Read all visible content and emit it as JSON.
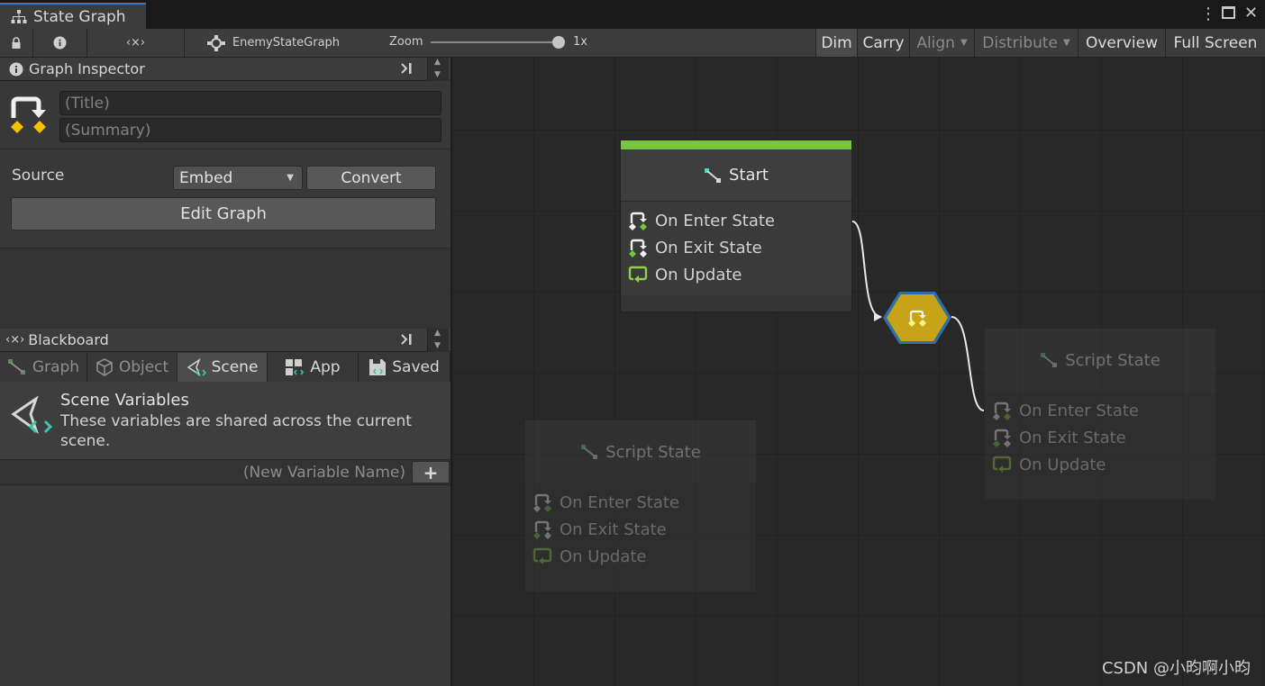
{
  "window": {
    "tab_title": "State Graph"
  },
  "toolbar": {
    "graph_name": "EnemyStateGraph",
    "zoom_label": "Zoom",
    "zoom_value": "1x",
    "buttons": {
      "dim": "Dim",
      "carry": "Carry",
      "align": "Align",
      "distribute": "Distribute",
      "overview": "Overview",
      "fullscreen": "Full Screen"
    }
  },
  "graph_inspector": {
    "header": "Graph Inspector",
    "title_placeholder": "(Title)",
    "summary_placeholder": "(Summary)",
    "source_label": "Source",
    "source_value": "Embed",
    "convert_label": "Convert",
    "edit_graph_label": "Edit Graph"
  },
  "blackboard": {
    "header": "Blackboard",
    "tabs": [
      {
        "label": "Graph",
        "active": false
      },
      {
        "label": "Object",
        "active": false
      },
      {
        "label": "Scene",
        "active": true
      },
      {
        "label": "App",
        "active": false
      },
      {
        "label": "Saved",
        "active": false
      }
    ],
    "section_title": "Scene Variables",
    "section_desc": "These variables are shared across the current scene.",
    "new_variable_placeholder": "(New Variable Name)",
    "add_button": "+"
  },
  "graph": {
    "start_node": {
      "title": "Start",
      "ports": [
        "On Enter State",
        "On Exit State",
        "On Update"
      ],
      "accent": "#6fbf3a"
    },
    "script_state_right": {
      "title": "Script State",
      "ports": [
        "On Enter State",
        "On Exit State",
        "On Update"
      ]
    },
    "script_state_left": {
      "title": "Script State",
      "ports": [
        "On Enter State",
        "On Exit State",
        "On Update"
      ]
    },
    "transition_color": "#c7a317"
  },
  "watermark": "CSDN @小昀啊小昀"
}
